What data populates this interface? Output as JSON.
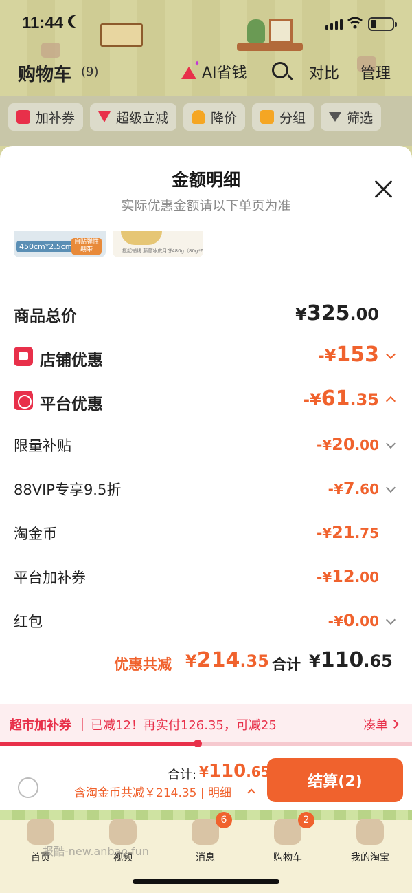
{
  "status_bar": {
    "time": "11:44"
  },
  "header": {
    "title": "购物车",
    "count": "(9)",
    "ai_label": "AI省钱",
    "compare_label": "对比",
    "manage_label": "管理"
  },
  "filters": [
    {
      "label": "加补券",
      "icon": "voucher-icon",
      "color": "#e8304a"
    },
    {
      "label": "超级立减",
      "icon": "down-arrow-icon",
      "color": "#e8304a"
    },
    {
      "label": "降价",
      "icon": "price-drop-icon",
      "color": "#f5a623"
    },
    {
      "label": "分组",
      "icon": "folder-icon",
      "color": "#f5a623"
    },
    {
      "label": "筛选",
      "icon": "filter-icon",
      "color": "#333333"
    }
  ],
  "sheet": {
    "title": "金额明细",
    "subtitle": "实际优惠金额请以下单页为准",
    "thumb1_size": "450cm*2.5cm",
    "thumb1_tag": "自贴弹性绷带",
    "thumb2_caption": "揽起辅线 藤蔓冰皮月饼480g（80g*6）",
    "rows": {
      "total": {
        "label": "商品总价",
        "prefix": "¥",
        "int": "325",
        "dec": ".00"
      },
      "shop": {
        "label": "店铺优惠",
        "prefix": "-¥",
        "int": "153",
        "dec": ""
      },
      "platform": {
        "label": "平台优惠",
        "prefix": "-¥",
        "int": "61",
        "dec": ".35"
      },
      "limited": {
        "label": "限量补贴",
        "prefix": "-¥",
        "int": "20",
        "dec": ".00"
      },
      "vip": {
        "label": "88VIP专享9.5折",
        "prefix": "-¥",
        "int": "7",
        "dec": ".60"
      },
      "coins": {
        "label": "淘金币",
        "prefix": "-¥",
        "int": "21",
        "dec": ".75"
      },
      "voucher": {
        "label": "平台加补券",
        "prefix": "-¥",
        "int": "12",
        "dec": ".00"
      },
      "redpacket": {
        "label": "红包",
        "prefix": "-¥",
        "int": "0",
        "dec": ".00"
      }
    },
    "summary": {
      "discount_label": "优惠共减",
      "discount_prefix": "¥",
      "discount_int": "214",
      "discount_dec": ".35",
      "total_label": "合计",
      "total_prefix": "¥",
      "total_int": "110",
      "total_dec": ".65"
    }
  },
  "voucher_bar": {
    "title": "超市加补券",
    "text": "已减12！再实付126.35，可减25",
    "link": "凑单",
    "progress": 0.48
  },
  "checkout": {
    "total_label": "合计:",
    "total_prefix": "¥",
    "total_int": "110",
    "total_dec": ".65",
    "detail": "含淘金币共减￥214.35 | 明细",
    "button": "结算(2)"
  },
  "tabbar": {
    "items": [
      {
        "label": "首页"
      },
      {
        "label": "视频"
      },
      {
        "label": "消息",
        "badge": "6"
      },
      {
        "label": "购物车",
        "badge": "2"
      },
      {
        "label": "我的淘宝"
      }
    ],
    "watermark": "报酷-new.anbao.fun"
  },
  "colors": {
    "accent": "#f0622d",
    "red": "#e8304a"
  }
}
